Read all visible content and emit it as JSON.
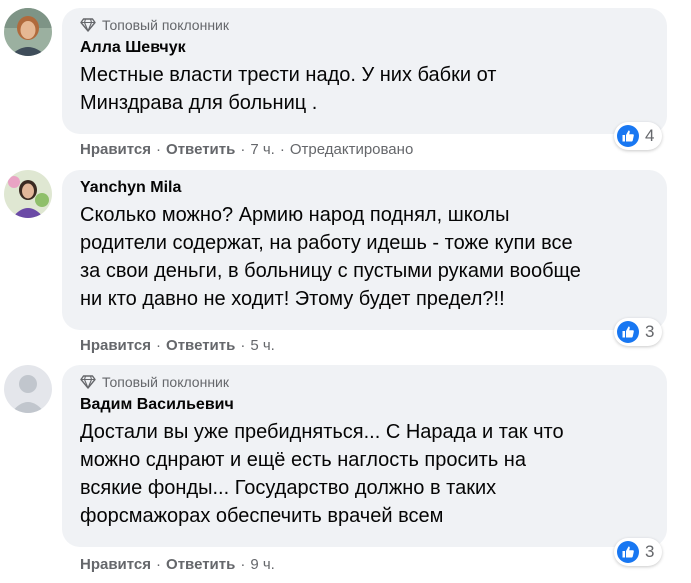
{
  "comments": [
    {
      "badge": "Топовый поклонник",
      "author": "Алла Шевчук",
      "text": "Местные власти трести надо. У них бабки от\nМинздрава для больниц .",
      "reaction_count": "4",
      "like_label": "Нравится",
      "reply_label": "Ответить",
      "time": "7 ч.",
      "edited": "Отредактировано",
      "avatar": "user-photo"
    },
    {
      "badge": "",
      "author": "Yanchyn Mila",
      "text": "Сколько можно? Армию народ поднял, школы\nродители содержат, на работу идешь - тоже купи все\nза свои деньги, в больницу с пустыми руками вообще\nни кто давно не ходит! Этому будет предел?!!",
      "reaction_count": "3",
      "like_label": "Нравится",
      "reply_label": "Ответить",
      "time": "5 ч.",
      "avatar": "user-photo"
    },
    {
      "badge": "Топовый поклонник",
      "author": "Вадим Васильевич",
      "text": "Достали вы уже пребидняться... С Нарада и так что\nможно сднрают и ещё есть наглость просить на\nвсякие фонды... Государство должно в таких\nфорсмажорах обеспечить врачей всем",
      "reaction_count": "3",
      "like_label": "Нравится",
      "reply_label": "Ответить",
      "time": "9 ч.",
      "avatar": "default-avatar"
    }
  ],
  "separator": "·",
  "colors": {
    "bubble": "#f0f2f5",
    "secondary_text": "#65676b",
    "like_blue": "#1877f2"
  }
}
